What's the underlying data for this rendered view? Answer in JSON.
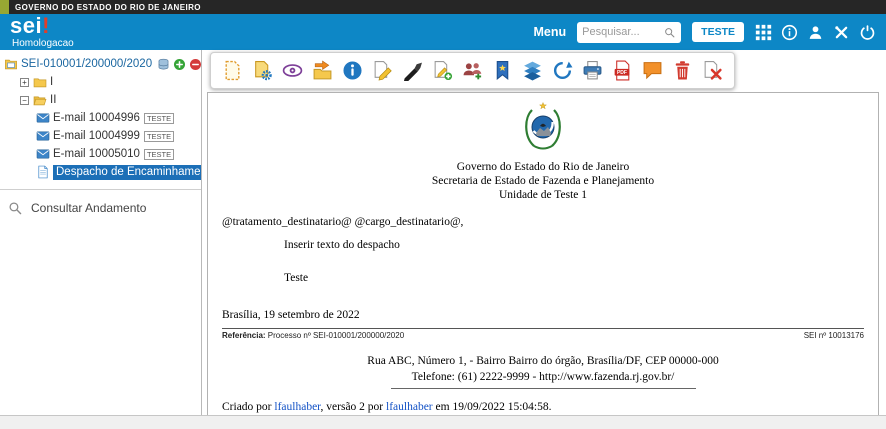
{
  "gov_bar": {
    "label": "GOVERNO DO ESTADO DO RIO DE JANEIRO"
  },
  "header": {
    "logo_text": "sei",
    "logo_accent": "!",
    "environment": "Homologacao",
    "menu_label": "Menu",
    "search_placeholder": "Pesquisar...",
    "user_button_label": "TESTE",
    "icons": [
      {
        "name": "apps-grid",
        "icon": "grid"
      },
      {
        "name": "about-info",
        "icon": "info-circle-outline"
      },
      {
        "name": "user-profile",
        "icon": "user"
      },
      {
        "name": "system-tools",
        "icon": "tools"
      },
      {
        "name": "logout-power",
        "icon": "power"
      }
    ],
    "colors": {
      "header_bg": "#0d87c6",
      "logo_accent": "#e23d28"
    }
  },
  "tree": {
    "process_number": "SEI-010001/200000/2020",
    "folders": [
      {
        "label": "I",
        "toggle": "+",
        "expanded": false
      },
      {
        "label": "II",
        "toggle": "−",
        "expanded": true
      }
    ],
    "documents": [
      {
        "label": "E-mail 10004996",
        "badge": "TESTE"
      },
      {
        "label": "E-mail 10004999",
        "badge": "TESTE"
      },
      {
        "label": "E-mail 10005010",
        "badge": "TESTE"
      },
      {
        "label": "Despacho de Encaminhamento de",
        "selected": true
      }
    ],
    "consult_link": "Consultar Andamento",
    "colors": {
      "selection_bg": "#1c6fb7",
      "process_link": "#1a66a0"
    }
  },
  "toolbar": {
    "buttons": [
      {
        "name": "include-document",
        "icon": "doc-dashed"
      },
      {
        "name": "document-permissions",
        "icon": "doc-gear"
      },
      {
        "name": "view-document",
        "icon": "eye"
      },
      {
        "name": "move-document",
        "icon": "move"
      },
      {
        "name": "document-info",
        "icon": "info-circle"
      },
      {
        "name": "edit-content",
        "icon": "doc-edit"
      },
      {
        "name": "sign-document",
        "icon": "pen"
      },
      {
        "name": "add-annotation",
        "icon": "doc-annotate"
      },
      {
        "name": "assign-users",
        "icon": "users"
      },
      {
        "name": "add-bookmark",
        "icon": "bookmark-star"
      },
      {
        "name": "document-versions",
        "icon": "layers"
      },
      {
        "name": "version-history",
        "icon": "history"
      },
      {
        "name": "print-document",
        "icon": "printer"
      },
      {
        "name": "generate-pdf",
        "icon": "pdf"
      },
      {
        "name": "add-comment",
        "icon": "comment"
      },
      {
        "name": "delete-document",
        "icon": "trash"
      },
      {
        "name": "cancel-document",
        "icon": "doc-cancel"
      }
    ]
  },
  "document": {
    "org_lines": [
      "Governo do Estado do Rio de Janeiro",
      "Secretaria de Estado de Fazenda e Planejamento",
      "Unidade de Teste 1"
    ],
    "salutation": "@tratamento_destinatario@ @cargo_destinatario@,",
    "body_line_1": "Inserir texto do despacho",
    "body_line_2": "Teste",
    "dateline": "Brasília, 19 setembro de 2022",
    "reference_label": "Referência:",
    "reference_value": " Processo nº SEI-010001/200000/2020",
    "sei_number": "SEI nº 10013176",
    "address_line": "Rua ABC, Número 1, - Bairro Bairro do órgão, Brasília/DF, CEP 00000-000",
    "phone_line": "Telefone: (61) 2222-9999 - http://www.fazenda.rj.gov.br/",
    "creator": {
      "prefix": "Criado por ",
      "user_1": "lfaulhaber",
      "middle": ", versão 2 por ",
      "user_2": "lfaulhaber",
      "suffix": " em 19/09/2022 15:04:58."
    }
  }
}
